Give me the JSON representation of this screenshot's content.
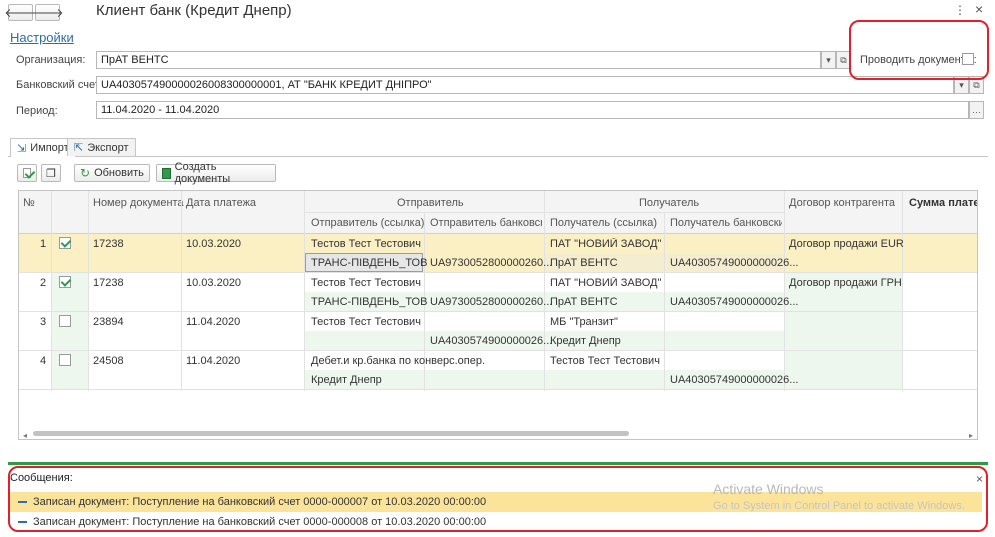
{
  "window": {
    "title": "Клиент банк (Кредит Днепр)",
    "more_icon": "⋮",
    "close_icon": "×"
  },
  "settings_link": "Настройки",
  "form": {
    "org_label": "Организация:",
    "org_value": "ПрАТ ВЕНТС",
    "account_label": "Банковский счет:",
    "account_value": "UA403057490000026008300000001, АТ \"БАНК КРЕДИТ ДНІПРО\"",
    "period_label": "Период:",
    "period_value": "11.04.2020 - 11.04.2020",
    "post_docs_label": "Проводить документы:",
    "post_docs_checked": false
  },
  "tabs": [
    {
      "label": "Импорт",
      "active": true
    },
    {
      "label": "Экспорт",
      "active": false
    }
  ],
  "toolbar": {
    "refresh_label": "Обновить",
    "create_label": "Создать документы"
  },
  "table": {
    "headers": {
      "num": "№",
      "doc_number": "Номер документа",
      "pay_date": "Дата платежа",
      "sender": "Отправитель",
      "sender_ref": "Отправитель (ссылка)",
      "sender_bank": "Отправитель банковский",
      "receiver": "Получатель",
      "receiver_ref": "Получатель (ссылка)",
      "receiver_bank": "Получатель банковский",
      "contract": "Договор контрагента",
      "amount": "Сумма платежа"
    },
    "rows": [
      {
        "num": "1",
        "checked": true,
        "doc": "17238",
        "date": "10.03.2020",
        "s_ref_1": "Тестов Тест Тестович",
        "s_ref_2": "ТРАНС-ПІВДЕНЬ_ТОВ",
        "s_bank_2": "UA9730052800000260...",
        "r_ref_1": "ПАТ \"НОВИЙ ЗАВОД\"",
        "r_ref_2": "ПрАТ ВЕНТС",
        "r_bank_2": "UA40305749000000026...",
        "contract": "Договор продажи EUR"
      },
      {
        "num": "2",
        "checked": true,
        "doc": "17238",
        "date": "10.03.2020",
        "s_ref_1": "Тестов Тест Тестович",
        "s_ref_2": "ТРАНС-ПІВДЕНЬ_ТОВ",
        "s_bank_2": "UA9730052800000260...",
        "r_ref_1": "ПАТ \"НОВИЙ ЗАВОД\"",
        "r_ref_2": "ПрАТ ВЕНТС",
        "r_bank_2": "UA40305749000000026...",
        "contract": "Договор продажи ГРН"
      },
      {
        "num": "3",
        "checked": false,
        "doc": "23894",
        "date": "11.04.2020",
        "s_ref_1": "Тестов Тест Тестович",
        "s_ref_2": "",
        "s_bank_2": "UA4030574900000026...",
        "r_ref_1": "МБ \"Транзит\"",
        "r_ref_2": "Кредит Днепр",
        "r_bank_2": "",
        "contract": ""
      },
      {
        "num": "4",
        "checked": false,
        "doc": "24508",
        "date": "11.04.2020",
        "s_ref_1": "Дебет.и кр.банка по конверс.опер.",
        "s_ref_2": "Кредит Днепр",
        "s_bank_2": "",
        "r_ref_1": "Тестов Тест Тестович",
        "r_ref_2": "",
        "r_bank_2": "UA40305749000000026...",
        "contract": ""
      }
    ]
  },
  "messages": {
    "title": "Сообщения:",
    "items": [
      "Записан документ: Поступление на банковский счет 0000-000007 от 10.03.2020 00:00:00",
      "Записан документ: Поступление на банковский счет 0000-000008 от 10.03.2020 00:00:00"
    ]
  },
  "watermark": {
    "line1": "Activate Windows",
    "line2": "Go to System in Control Panel to activate Windows."
  },
  "colors": {
    "selected_row": "#fbf0c4",
    "alt_cell": "#eef7ee",
    "accent_green": "#2e9b4a",
    "link_blue": "#2c6dac",
    "highlight_red": "#e0202a"
  }
}
